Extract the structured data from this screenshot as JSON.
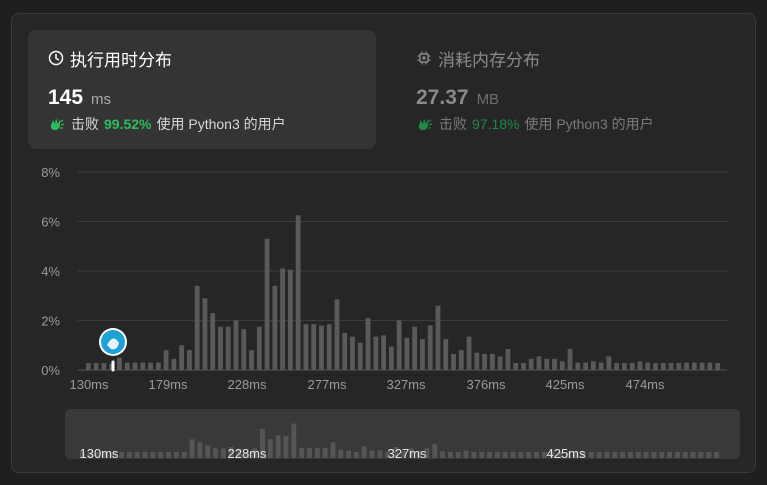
{
  "runtime_card": {
    "title": "执行用时分布",
    "value": "145",
    "unit": "ms",
    "beat_label": "击败",
    "beat_percent": "99.52%",
    "beat_suffix": "使用 Python3 的用户"
  },
  "memory_card": {
    "title": "消耗内存分布",
    "value": "27.37",
    "unit": "MB",
    "beat_label": "击败",
    "beat_percent": "97.18%",
    "beat_suffix": "使用 Python3 的用户"
  },
  "colors": {
    "accent_green": "#2cbb5d",
    "bar": "#5a5a5a",
    "grid": "#3d3d3d",
    "marker": "#1ea1d4"
  },
  "chart_data": {
    "type": "bar",
    "y_ticks": [
      "8%",
      "6%",
      "4%",
      "2%",
      "0%"
    ],
    "ylim": [
      0,
      8
    ],
    "x_ticks": [
      "130ms",
      "179ms",
      "228ms",
      "277ms",
      "327ms",
      "376ms",
      "425ms",
      "474ms"
    ],
    "overview_x_ticks": [
      "130ms",
      "228ms",
      "327ms",
      "425ms"
    ],
    "current_runtime": "145ms",
    "values": [
      0.28,
      0.28,
      0.28,
      0.25,
      0.5,
      0.3,
      0.3,
      0.3,
      0.3,
      0.3,
      0.8,
      0.45,
      1.0,
      0.8,
      3.4,
      2.9,
      2.3,
      1.75,
      1.75,
      2.0,
      1.65,
      0.8,
      1.75,
      5.3,
      3.4,
      4.1,
      4.05,
      6.25,
      1.85,
      1.85,
      1.8,
      1.85,
      2.85,
      1.5,
      1.35,
      1.1,
      2.1,
      1.35,
      1.4,
      0.95,
      2.0,
      1.3,
      1.75,
      1.25,
      1.8,
      2.6,
      1.25,
      0.65,
      0.8,
      1.35,
      0.7,
      0.65,
      0.65,
      0.55,
      0.85,
      0.28,
      0.28,
      0.45,
      0.55,
      0.45,
      0.45,
      0.35,
      0.85,
      0.3,
      0.3,
      0.35,
      0.3,
      0.55,
      0.28,
      0.28,
      0.28,
      0.35,
      0.3,
      0.28,
      0.28,
      0.28,
      0.28,
      0.3,
      0.3,
      0.3,
      0.3,
      0.28
    ]
  }
}
